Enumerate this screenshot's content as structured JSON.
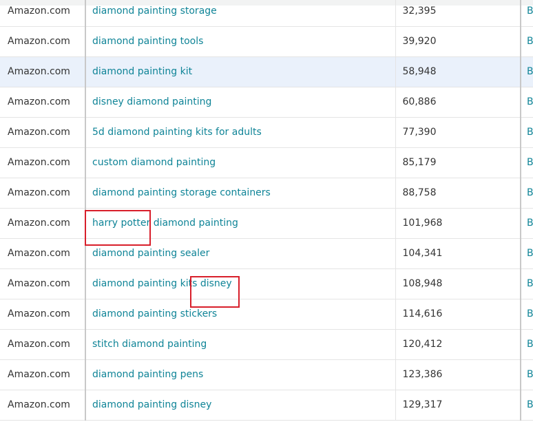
{
  "rows": [
    {
      "source": "Amazon.com",
      "keyword": "diamond painting storage",
      "rank": "32,395",
      "extra": "B"
    },
    {
      "source": "Amazon.com",
      "keyword": "diamond painting tools",
      "rank": "39,920",
      "extra": "B"
    },
    {
      "source": "Amazon.com",
      "keyword": "diamond painting kit",
      "rank": "58,948",
      "extra": "B"
    },
    {
      "source": "Amazon.com",
      "keyword": "disney diamond painting",
      "rank": "60,886",
      "extra": "B"
    },
    {
      "source": "Amazon.com",
      "keyword": "5d diamond painting kits for adults",
      "rank": "77,390",
      "extra": "B"
    },
    {
      "source": "Amazon.com",
      "keyword": "custom diamond painting",
      "rank": "85,179",
      "extra": "B"
    },
    {
      "source": "Amazon.com",
      "keyword": "diamond painting storage containers",
      "rank": "88,758",
      "extra": "B"
    },
    {
      "source": "Amazon.com",
      "keyword": "harry potter diamond painting",
      "rank": "101,968",
      "extra": "B"
    },
    {
      "source": "Amazon.com",
      "keyword": "diamond painting sealer",
      "rank": "104,341",
      "extra": "B"
    },
    {
      "source": "Amazon.com",
      "keyword": "diamond painting kits disney",
      "rank": "108,948",
      "extra": "B"
    },
    {
      "source": "Amazon.com",
      "keyword": "diamond painting stickers",
      "rank": "114,616",
      "extra": "B"
    },
    {
      "source": "Amazon.com",
      "keyword": "stitch diamond painting",
      "rank": "120,412",
      "extra": "B"
    },
    {
      "source": "Amazon.com",
      "keyword": "diamond painting pens",
      "rank": "123,386",
      "extra": "B"
    },
    {
      "source": "Amazon.com",
      "keyword": "diamond painting disney",
      "rank": "129,317",
      "extra": "B"
    }
  ],
  "colors": {
    "link": "#0f8497",
    "highlight_row": "#eaf1fb",
    "annotation_box": "#d81e2a"
  }
}
